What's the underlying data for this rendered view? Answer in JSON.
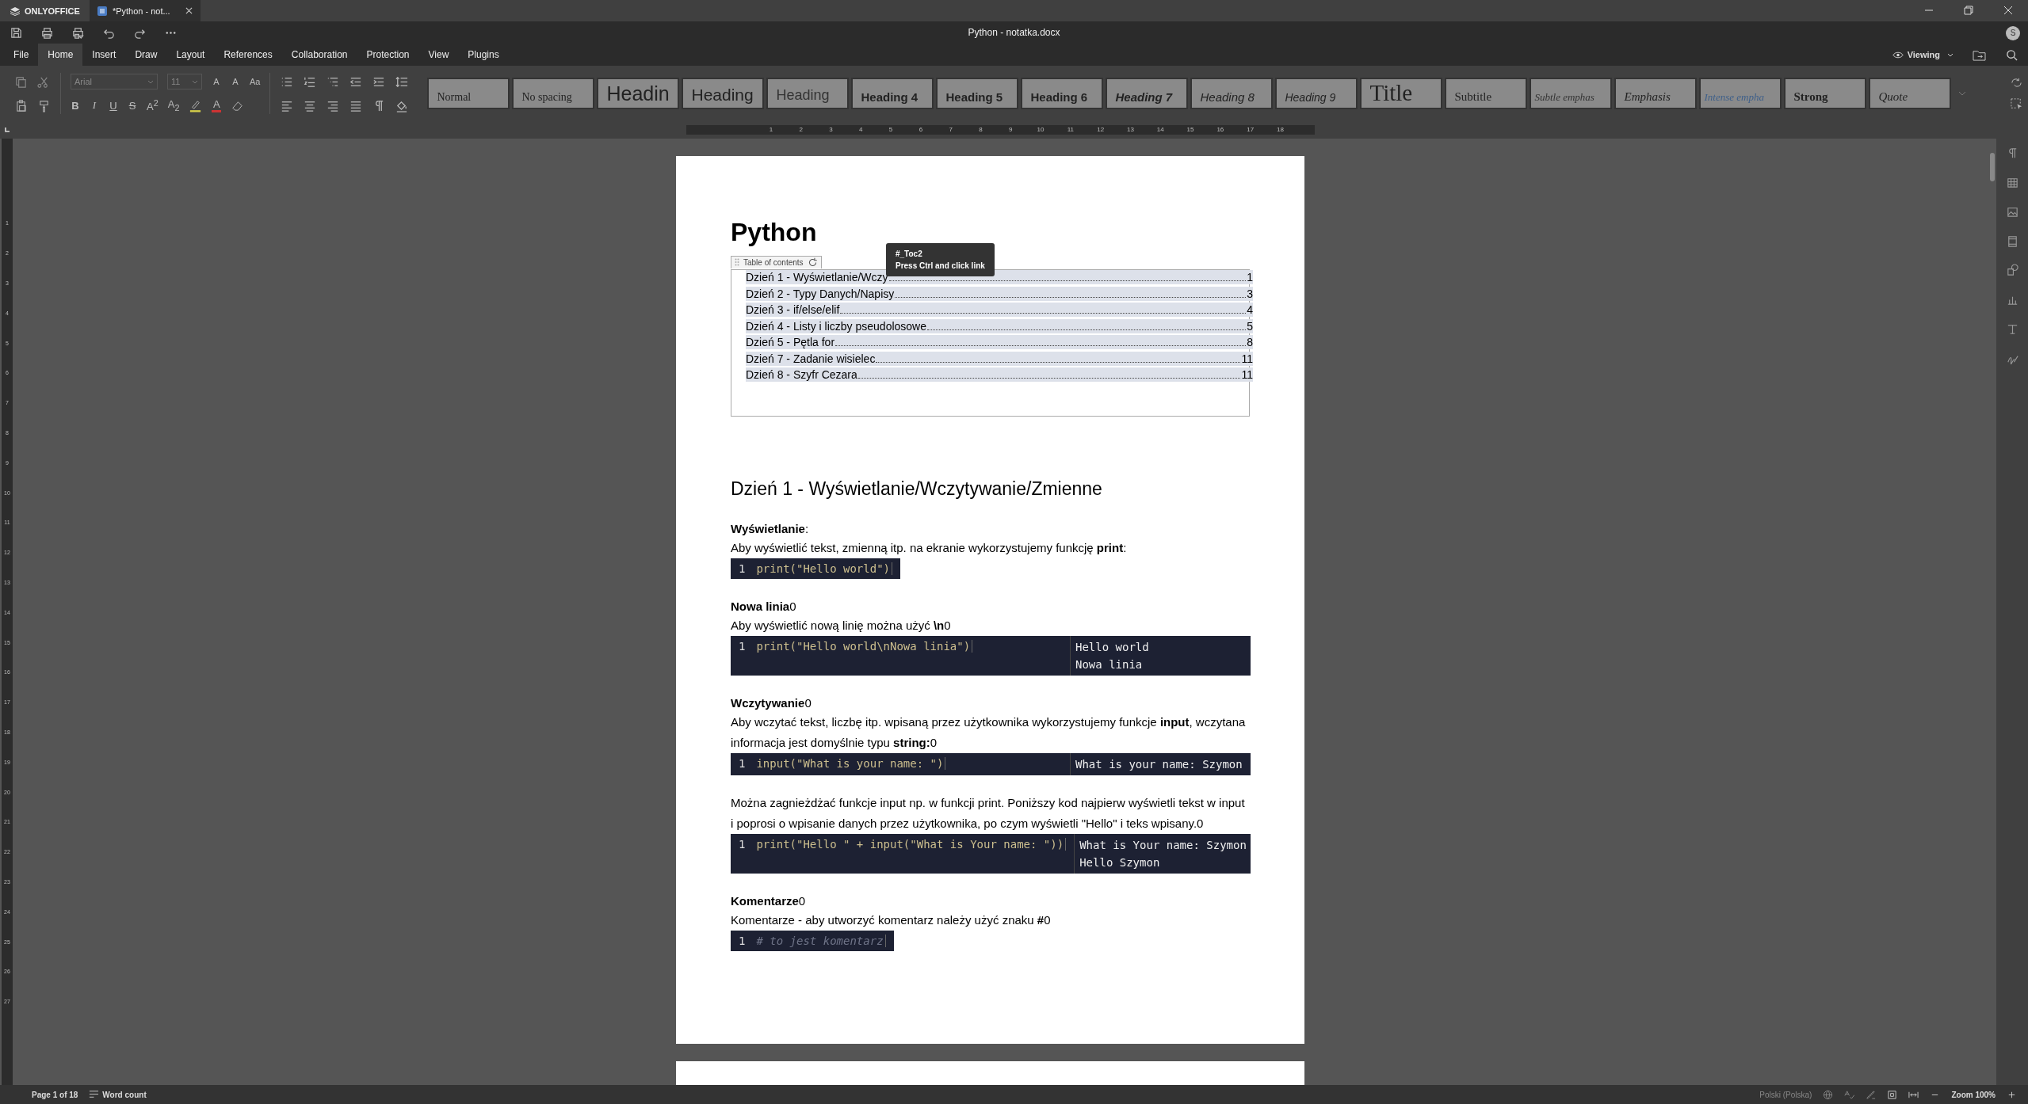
{
  "app": {
    "brand": "ONLYOFFICE"
  },
  "tabs": [
    {
      "label": "*Python - not...",
      "selected": true
    }
  ],
  "window": {
    "title": "Python - notatka.docx",
    "user_initial": "S"
  },
  "menu": [
    {
      "label": "File",
      "selected": false
    },
    {
      "label": "Home",
      "selected": true
    },
    {
      "label": "Insert",
      "selected": false
    },
    {
      "label": "Draw",
      "selected": false
    },
    {
      "label": "Layout",
      "selected": false
    },
    {
      "label": "References",
      "selected": false
    },
    {
      "label": "Collaboration",
      "selected": false
    },
    {
      "label": "Protection",
      "selected": false
    },
    {
      "label": "View",
      "selected": false
    },
    {
      "label": "Plugins",
      "selected": false
    }
  ],
  "mode": "Viewing",
  "font": {
    "name": "Arial",
    "size": "11"
  },
  "size_glyphs": [
    "A",
    "A",
    "Aa"
  ],
  "format_glyphs": [
    {
      "glyph": "B",
      "kind": "bold"
    },
    {
      "glyph": "I",
      "kind": "italic"
    },
    {
      "glyph": "U",
      "kind": "underline"
    },
    {
      "glyph": "S",
      "kind": "strike"
    },
    {
      "glyph": "A$^{2}$",
      "kind": "super"
    },
    {
      "glyph": "A$_{2}$",
      "kind": "sub"
    }
  ],
  "font_color_glyph": "A",
  "styles": [
    {
      "label": "Normal",
      "kind": "normal"
    },
    {
      "label": "No spacing",
      "kind": "normal"
    },
    {
      "label": "Headin",
      "kind": "h1"
    },
    {
      "label": "Heading",
      "kind": "h2"
    },
    {
      "label": "Heading",
      "kind": "h3"
    },
    {
      "label": "Heading 4",
      "kind": "h4"
    },
    {
      "label": "Heading 5",
      "kind": "h4"
    },
    {
      "label": "Heading 6",
      "kind": "h4"
    },
    {
      "label": "Heading 7",
      "kind": "h7"
    },
    {
      "label": "Heading 8",
      "kind": "h8"
    },
    {
      "label": "Heading 9",
      "kind": "h9"
    },
    {
      "label": "Title",
      "kind": "title"
    },
    {
      "label": "Subtitle",
      "kind": "subtitle"
    },
    {
      "label": "Subtle emphas",
      "kind": "subtle"
    },
    {
      "label": "Emphasis",
      "kind": "emphasis"
    },
    {
      "label": "Intense empha",
      "kind": "intense"
    },
    {
      "label": "Strong",
      "kind": "strong"
    },
    {
      "label": "Quote",
      "kind": "quote"
    }
  ],
  "ruler": {
    "h": [
      "1",
      "2",
      "3",
      "4",
      "5",
      "6",
      "7",
      "8",
      "9",
      "10",
      "11",
      "12",
      "13",
      "14",
      "15",
      "16",
      "17",
      "18"
    ],
    "v": [
      "1",
      "2",
      "3",
      "4",
      "5",
      "6",
      "7",
      "8",
      "9",
      "10",
      "11",
      "12",
      "13",
      "14",
      "15",
      "16",
      "17",
      "18",
      "19",
      "20",
      "21",
      "22",
      "23",
      "24",
      "25",
      "26",
      "27"
    ]
  },
  "document": {
    "title": "Python",
    "toc": {
      "label": "Table of contents",
      "entries": [
        {
          "text": "Dzień 1 - Wyświetlanie/Wczy",
          "page": "1"
        },
        {
          "text": "Dzień 2 - Typy Danych/Napisy",
          "page": "3"
        },
        {
          "text": "Dzień 3 - if/else/elif",
          "page": "4"
        },
        {
          "text": "Dzień 4 - Listy i liczby pseudolosowe",
          "page": "5"
        },
        {
          "text": "Dzień 5 - Pętla for",
          "page": "8"
        },
        {
          "text": "Dzień 7 - Zadanie wisielec",
          "page": "11"
        },
        {
          "text": "Dzień 8 - Szyfr Cezara",
          "page": "11"
        }
      ]
    },
    "tooltip": {
      "target": "#_Toc2",
      "hint": "Press Ctrl and click link"
    },
    "heading": "Dzień 1 - Wyświetlanie/Wczytywanie/Zmienne",
    "blocks": [
      {
        "kind": "label",
        "text": "**Wyświetlanie**:"
      },
      {
        "kind": "para",
        "text": "Aby wyświetlić tekst, zmienną itp. na ekranie wykorzystujemy funkcję **print**:"
      },
      {
        "kind": "code",
        "number": "1",
        "code": "print(\"Hello world\")"
      },
      {
        "kind": "label",
        "text": "**Nowa linia**0"
      },
      {
        "kind": "para",
        "text": "Aby wyświetlić nową linię można użyć **\\n**0"
      },
      {
        "kind": "code",
        "number": "1",
        "code": "print(\"Hello world\\nNowa linia\")",
        "output": [
          "Hello world",
          "Nowa linia"
        ]
      },
      {
        "kind": "label",
        "text": "**Wczytywanie**0"
      },
      {
        "kind": "para",
        "text": "Aby wczytać tekst, liczbę itp. wpisaną przez użytkownika wykorzystujemy funkcje **input**, wczytana informacja jest domyślnie typu **string:**0"
      },
      {
        "kind": "code",
        "number": "1",
        "code": "input(\"What is your name: \")",
        "output": [
          "What is your name: Szymon"
        ]
      },
      {
        "kind": "para",
        "text": "Można zagnieżdżać funkcje input np. w funkcji print. Poniższy kod najpierw wyświetli tekst w input i poprosi o wpisanie danych przez użytkownika, po czym wyświetli \"Hello\" i teks wpisany.0"
      },
      {
        "kind": "code",
        "number": "1",
        "code": "print(\"Hello \" + input(\"What is Your name: \"))",
        "output": [
          "What is Your name: Szymon",
          "Hello Szymon"
        ]
      },
      {
        "kind": "label",
        "text": "**Komentarze**0"
      },
      {
        "kind": "para",
        "text": "Komentarze - aby utworzyć komentarz należy użyć znaku **#**0"
      },
      {
        "kind": "comment",
        "number": "1",
        "code": "# to jest komentarz"
      }
    ]
  },
  "status": {
    "page": "Page 1 of 18",
    "word_count": "Word count",
    "language": "Polski (Polska)",
    "zoom": "Zoom 100%"
  }
}
